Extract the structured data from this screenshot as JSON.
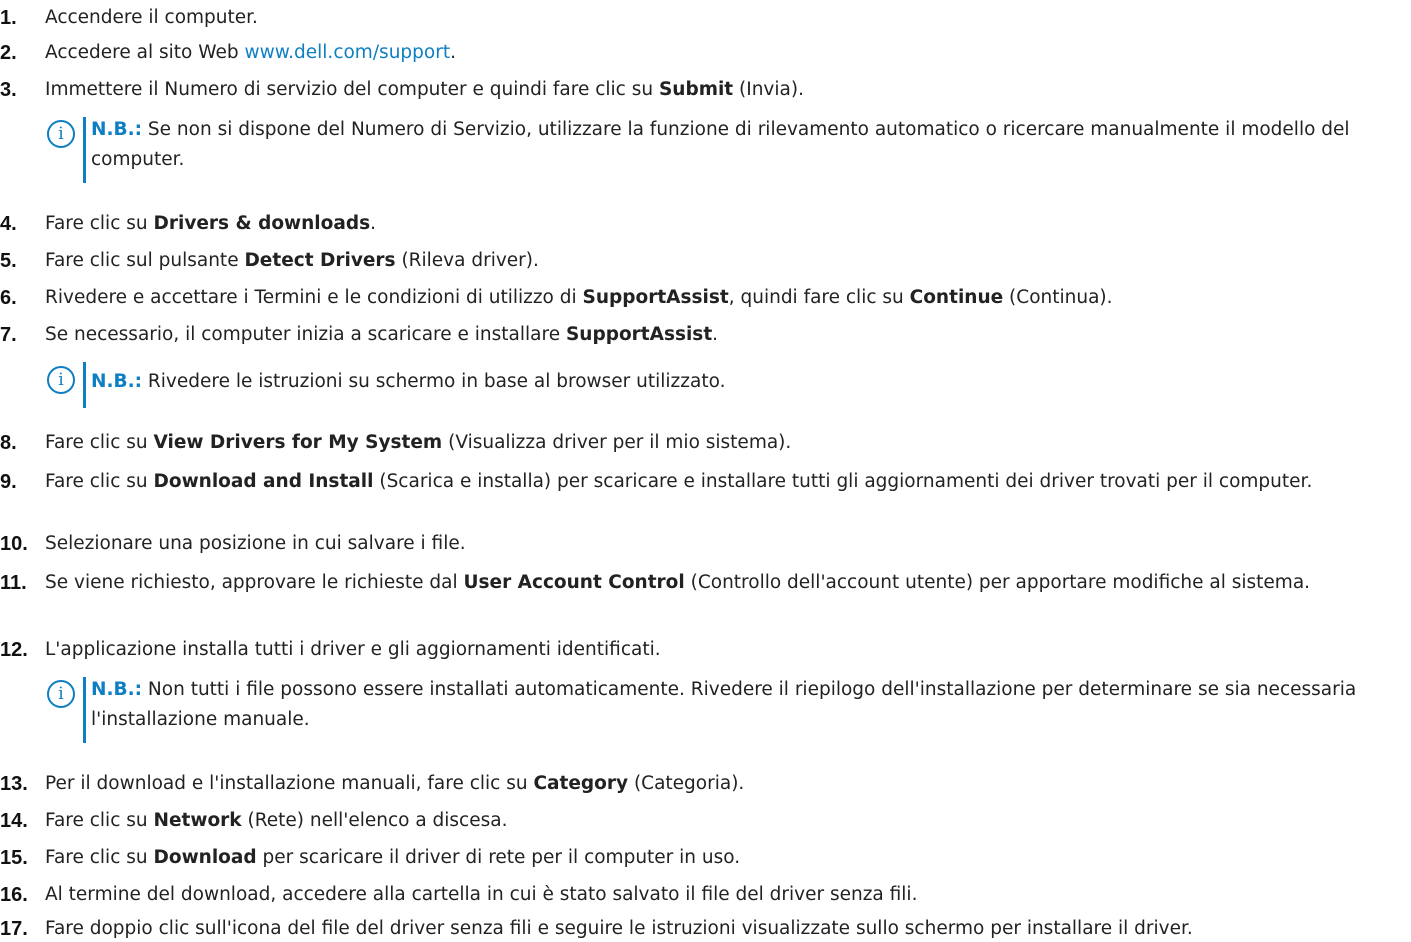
{
  "steps": [
    {
      "num": "1.",
      "parts": [
        {
          "t": "Accendere il computer."
        }
      ]
    },
    {
      "num": "2.",
      "parts": [
        {
          "t": "Accedere al sito Web "
        },
        {
          "t": "www.dell.com/support",
          "link": true
        },
        {
          "t": "."
        }
      ]
    },
    {
      "num": "3.",
      "parts": [
        {
          "t": "Immettere il Numero di servizio del computer e quindi fare clic su "
        },
        {
          "t": "Submit",
          "b": true
        },
        {
          "t": " (Invia)."
        }
      ]
    },
    {
      "num": "4.",
      "parts": [
        {
          "t": "Fare clic su "
        },
        {
          "t": "Drivers & downloads",
          "b": true
        },
        {
          "t": "."
        }
      ]
    },
    {
      "num": "5.",
      "parts": [
        {
          "t": "Fare clic sul pulsante "
        },
        {
          "t": "Detect Drivers",
          "b": true
        },
        {
          "t": " (Rileva driver)."
        }
      ]
    },
    {
      "num": "6.",
      "parts": [
        {
          "t": "Rivedere e accettare i Termini e le condizioni di utilizzo di "
        },
        {
          "t": "SupportAssist",
          "b": true
        },
        {
          "t": ", quindi fare clic su "
        },
        {
          "t": "Continue",
          "b": true
        },
        {
          "t": " (Continua)."
        }
      ]
    },
    {
      "num": "7.",
      "parts": [
        {
          "t": "Se necessario, il computer inizia a scaricare e installare "
        },
        {
          "t": "SupportAssist",
          "b": true
        },
        {
          "t": "."
        }
      ]
    },
    {
      "num": "8.",
      "parts": [
        {
          "t": "Fare clic su "
        },
        {
          "t": "View Drivers for My System",
          "b": true
        },
        {
          "t": " (Visualizza driver per il mio sistema)."
        }
      ]
    },
    {
      "num": "9.",
      "parts": [
        {
          "t": "Fare clic su "
        },
        {
          "t": "Download and Install",
          "b": true
        },
        {
          "t": " (Scarica e installa) per scaricare e installare tutti gli aggiornamenti dei driver trovati per il computer."
        }
      ]
    },
    {
      "num": "10.",
      "parts": [
        {
          "t": "Selezionare una posizione in cui salvare i file."
        }
      ]
    },
    {
      "num": "11.",
      "parts": [
        {
          "t": "Se viene richiesto, approvare le richieste dal "
        },
        {
          "t": "User Account Control",
          "b": true
        },
        {
          "t": " (Controllo dell'account utente) per apportare modifiche al sistema."
        }
      ]
    },
    {
      "num": "12.",
      "parts": [
        {
          "t": "L'applicazione installa tutti i driver e gli aggiornamenti identificati."
        }
      ]
    },
    {
      "num": "13.",
      "parts": [
        {
          "t": "Per il download e l'installazione manuali, fare clic su "
        },
        {
          "t": "Category",
          "b": true
        },
        {
          "t": " (Categoria)."
        }
      ]
    },
    {
      "num": "14.",
      "parts": [
        {
          "t": "Fare clic su "
        },
        {
          "t": "Network",
          "b": true
        },
        {
          "t": " (Rete) nell'elenco a discesa."
        }
      ]
    },
    {
      "num": "15.",
      "parts": [
        {
          "t": "Fare clic su "
        },
        {
          "t": "Download",
          "b": true
        },
        {
          "t": " per scaricare il driver di rete per il computer in uso."
        }
      ]
    },
    {
      "num": "16.",
      "parts": [
        {
          "t": "Al termine del download, accedere alla cartella in cui è stato salvato il file del driver senza fili."
        }
      ]
    },
    {
      "num": "17.",
      "parts": [
        {
          "t": "Fare doppio clic sull'icona del file del driver senza fili e seguire le istruzioni visualizzate sullo schermo per installare il driver."
        }
      ]
    }
  ],
  "notes": [
    {
      "label": "N.B.:",
      "text": " Se non si dispone del Numero di Servizio, utilizzare la funzione di rilevamento automatico o ricercare manualmente il modello del computer."
    },
    {
      "label": "N.B.:",
      "text": " Rivedere le istruzioni su schermo in base al browser utilizzato."
    },
    {
      "label": "N.B.:",
      "text": " Non tutti i file possono essere installati automaticamente. Rivedere il riepilogo dell'installazione per determinare se sia necessaria l'installazione manuale."
    }
  ],
  "icons": {
    "note": "info-icon",
    "note_glyph": "i"
  },
  "colors": {
    "accent": "#0d7fc2",
    "text": "#222222"
  }
}
